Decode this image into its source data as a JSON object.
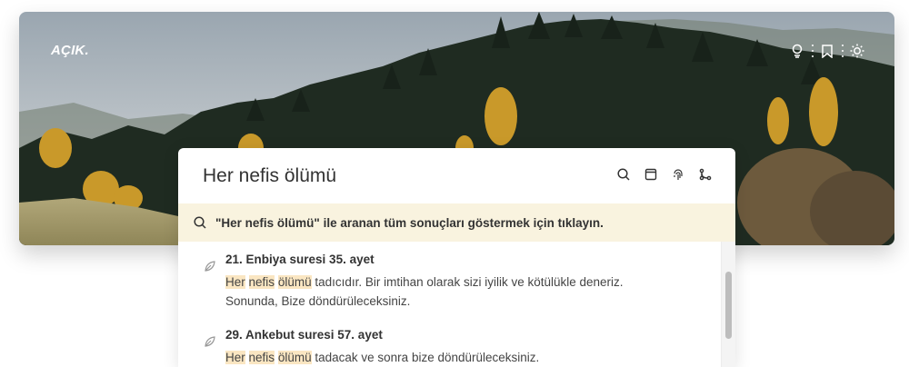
{
  "header": {
    "logo": "AÇIK.",
    "icons": [
      "lightbulb-icon",
      "bookmark-icon",
      "sun-icon"
    ]
  },
  "search": {
    "value": "Her nefis ölümü",
    "icons": [
      "search-icon",
      "book-icon",
      "fingerprint-icon",
      "branch-icon"
    ]
  },
  "all_results": {
    "label": "\"Her nefis ölümü\" ile aranan tüm sonuçları göstermek için tıklayın."
  },
  "results": [
    {
      "title": "21. Enbiya suresi 35. ayet",
      "highlights": [
        "Her",
        "nefis",
        "ölümü"
      ],
      "rest": "tadıcıdır. Bir imtihan olarak sizi iyilik ve kötülükle deneriz.",
      "line2": "Sonunda, Bize döndürüleceksiniz."
    },
    {
      "title": "29. Ankebut suresi 57. ayet",
      "highlights": [
        "Her",
        "nefis",
        "ölümü"
      ],
      "rest": "tadacak ve sonra bize döndürüleceksiniz.",
      "line2": ""
    }
  ],
  "colors": {
    "highlight": "#fae6c2",
    "banner": "#f9f3df"
  }
}
